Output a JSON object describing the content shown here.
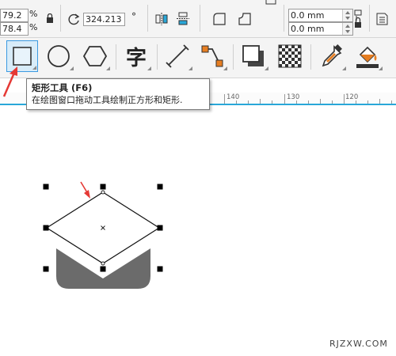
{
  "property_bar": {
    "scale_x": "79.2",
    "scale_y": "78.4",
    "percent": "%",
    "rotation": "324.213",
    "degree": "°",
    "outline_top": "0.0 mm",
    "outline_bottom": "0.0 mm"
  },
  "toolbox": {
    "text_tool_glyph": "字",
    "active_tool": "rectangle-tool"
  },
  "ruler": {
    "labels": [
      "140",
      "130",
      "120"
    ]
  },
  "tooltip": {
    "title": "矩形工具 (F6)",
    "body": "在绘图窗口拖动工具绘制正方形和矩形."
  },
  "canvas": {
    "shape_fill_color": "#6b6b6b",
    "selected_shape_fill": "#ffffff",
    "handle_color": "#000000",
    "arrow_color": "#e53935",
    "accent_color": "#3b9ae1"
  },
  "watermark": "RJZXW.COM"
}
